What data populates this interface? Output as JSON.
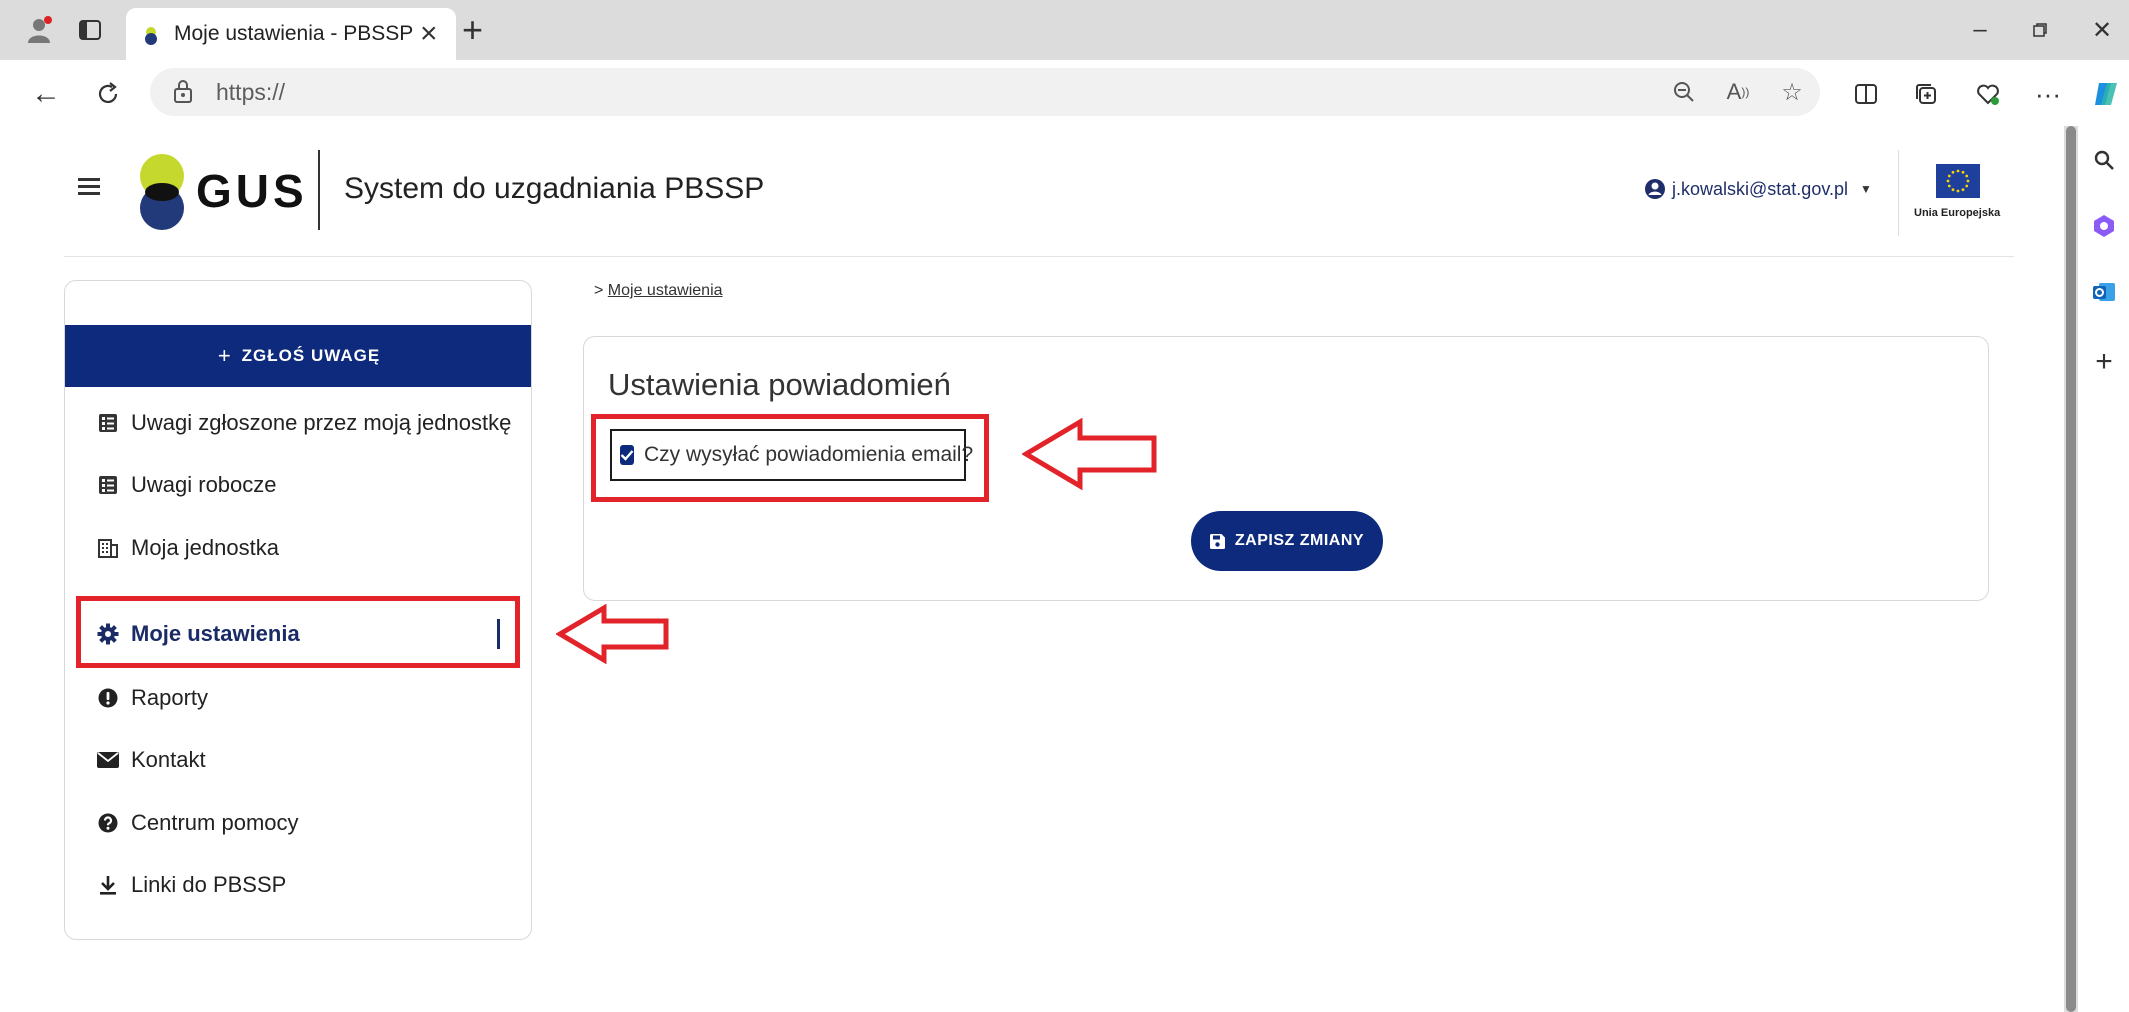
{
  "browser": {
    "tab_title": "Moje ustawienia - PBSSP",
    "url": "https://"
  },
  "header": {
    "logo_text": "GUS",
    "system_title": "System do uzgadniania PBSSP",
    "user_email": "j.kowalski@stat.gov.pl",
    "eu_label": "Unia Europejska"
  },
  "sidebar": {
    "report_button": "ZGŁOŚ UWAGĘ",
    "items": [
      {
        "label": "Uwagi zgłoszone przez moją jednostkę",
        "icon": "list-icon"
      },
      {
        "label": "Uwagi robocze",
        "icon": "list-icon"
      },
      {
        "label": "Moja jednostka",
        "icon": "building-icon"
      },
      {
        "label": "Moje ustawienia",
        "icon": "gear-icon",
        "active": true
      },
      {
        "label": "Raporty",
        "icon": "exclamation-icon"
      },
      {
        "label": "Kontakt",
        "icon": "envelope-icon"
      },
      {
        "label": "Centrum pomocy",
        "icon": "question-icon"
      },
      {
        "label": "Linki do PBSSP",
        "icon": "download-icon"
      }
    ]
  },
  "breadcrumb": {
    "prefix": ">",
    "current": "Moje ustawienia"
  },
  "settings": {
    "title": "Ustawienia powiadomień",
    "email_checkbox_label": "Czy wysyłać powiadomienia email?",
    "email_checkbox_checked": true,
    "save_button": "ZAPISZ ZMIANY"
  },
  "colors": {
    "primary": "#0d2a7c",
    "annotation": "#e2232a",
    "logo_lime": "#c5d82e",
    "logo_navy": "#233a7a"
  }
}
